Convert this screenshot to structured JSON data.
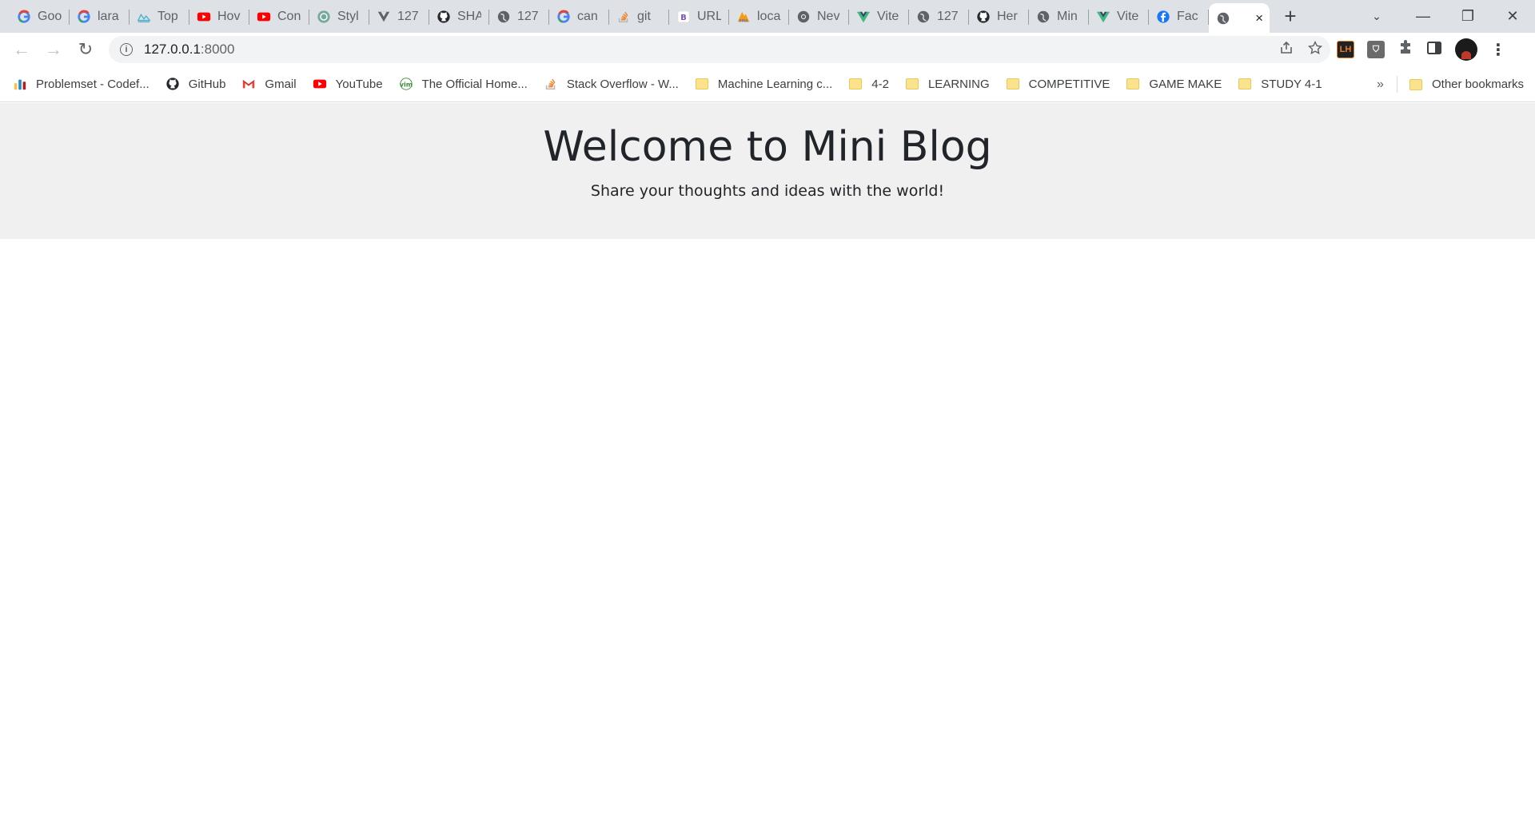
{
  "browser": {
    "tabs": [
      {
        "title": "Goo",
        "icon": "google-icon"
      },
      {
        "title": "lara",
        "icon": "google-icon"
      },
      {
        "title": "Top",
        "icon": "ide-icon"
      },
      {
        "title": "Hov",
        "icon": "youtube-icon"
      },
      {
        "title": "Con",
        "icon": "youtube-icon"
      },
      {
        "title": "Styl",
        "icon": "chatgpt-icon"
      },
      {
        "title": "127",
        "icon": "vue-dark-icon"
      },
      {
        "title": "SHA",
        "icon": "github-icon"
      },
      {
        "title": "127",
        "icon": "globe-icon"
      },
      {
        "title": "can",
        "icon": "google-icon"
      },
      {
        "title": "git",
        "icon": "stackoverflow-icon"
      },
      {
        "title": "URL",
        "icon": "bootstrap-icon"
      },
      {
        "title": "loca",
        "icon": "phpmyadmin-icon"
      },
      {
        "title": "Nev",
        "icon": "chrome-icon"
      },
      {
        "title": "Vite",
        "icon": "vue-icon"
      },
      {
        "title": "127",
        "icon": "globe-icon"
      },
      {
        "title": "Her",
        "icon": "github-icon"
      },
      {
        "title": "Min",
        "icon": "globe-icon"
      },
      {
        "title": "Vite",
        "icon": "vue-icon"
      },
      {
        "title": "Fac",
        "icon": "facebook-icon"
      }
    ],
    "active_tab": {
      "icon": "globe-icon",
      "close": "×"
    },
    "new_tab": "+",
    "window_controls": {
      "tab_search": "⌄",
      "minimize": "—",
      "restore": "❐",
      "close": "✕"
    },
    "address": {
      "host": "127.0.0.1",
      "port": ":8000"
    },
    "nav": {
      "back": "←",
      "forward": "→",
      "reload": "↻"
    },
    "bookmarks": [
      {
        "label": "Problemset - Codef...",
        "icon": "codeforces-icon"
      },
      {
        "label": "GitHub",
        "icon": "github-icon"
      },
      {
        "label": "Gmail",
        "icon": "gmail-icon"
      },
      {
        "label": "YouTube",
        "icon": "youtube-icon"
      },
      {
        "label": "The Official Home...",
        "icon": "vim-icon"
      },
      {
        "label": "Stack Overflow - W...",
        "icon": "stackoverflow-icon"
      },
      {
        "label": "Machine Learning c...",
        "icon": "folder-icon"
      },
      {
        "label": "4-2",
        "icon": "folder-icon"
      },
      {
        "label": "LEARNING",
        "icon": "folder-icon"
      },
      {
        "label": "COMPETITIVE",
        "icon": "folder-icon"
      },
      {
        "label": "GAME MAKE",
        "icon": "folder-icon"
      },
      {
        "label": "STUDY 4-1",
        "icon": "folder-icon"
      }
    ],
    "bookmarks_more": "»",
    "other_bookmarks": "Other bookmarks"
  },
  "page": {
    "title": "Welcome to Mini Blog",
    "subtitle": "Share your thoughts and ideas with the world!"
  },
  "colors": {
    "hero_background": "#f0f0f0",
    "text": "#212529",
    "tabstrip": "#dee1e6"
  }
}
